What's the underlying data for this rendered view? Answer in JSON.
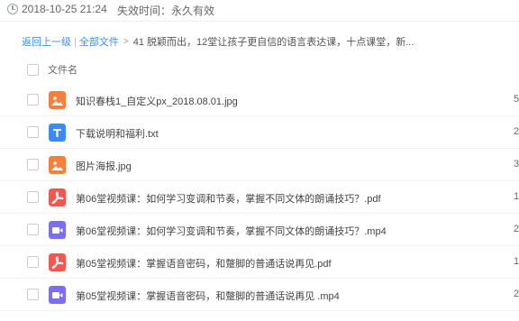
{
  "header": {
    "created": "2018-10-25 21:24",
    "expire_label": "失效时间：",
    "expire_value": "永久有效"
  },
  "breadcrumb": {
    "back": "返回上一级",
    "separator": "|",
    "all_files": "全部文件",
    "arrow": ">",
    "current": "41 脱颖而出，12堂让孩子更自信的语言表达课，十点课堂，新..."
  },
  "list": {
    "column_title": "文件名",
    "files": [
      {
        "name": "知识春栈1_自定义px_2018.08.01.jpg",
        "icon": "image-icon",
        "size": "5"
      },
      {
        "name": "下载说明和福利.txt",
        "icon": "text-icon",
        "size": "2"
      },
      {
        "name": "图片海报.jpg",
        "icon": "image-icon",
        "size": "3"
      },
      {
        "name": "第06堂视频课：如何学习变调和节奏，掌握不同文体的朗诵技巧？.pdf",
        "icon": "pdf-icon",
        "size": "1"
      },
      {
        "name": "第06堂视频课：如何学习变调和节奏，掌握不同文体的朗诵技巧？.mp4",
        "icon": "video-icon",
        "size": "2"
      },
      {
        "name": "第05堂视频课：掌握语音密码，和蹩脚的普通话说再见.pdf",
        "icon": "pdf-icon",
        "size": "1"
      },
      {
        "name": "第05堂视频课：掌握语音密码，和蹩脚的普通话说再见 .mp4",
        "icon": "video-icon",
        "size": "2"
      }
    ]
  },
  "colors": {
    "image": "#f5803e",
    "text": "#3d8af7",
    "pdf": "#f2584f",
    "video": "#7b6ff0",
    "link": "#3b8cff"
  }
}
